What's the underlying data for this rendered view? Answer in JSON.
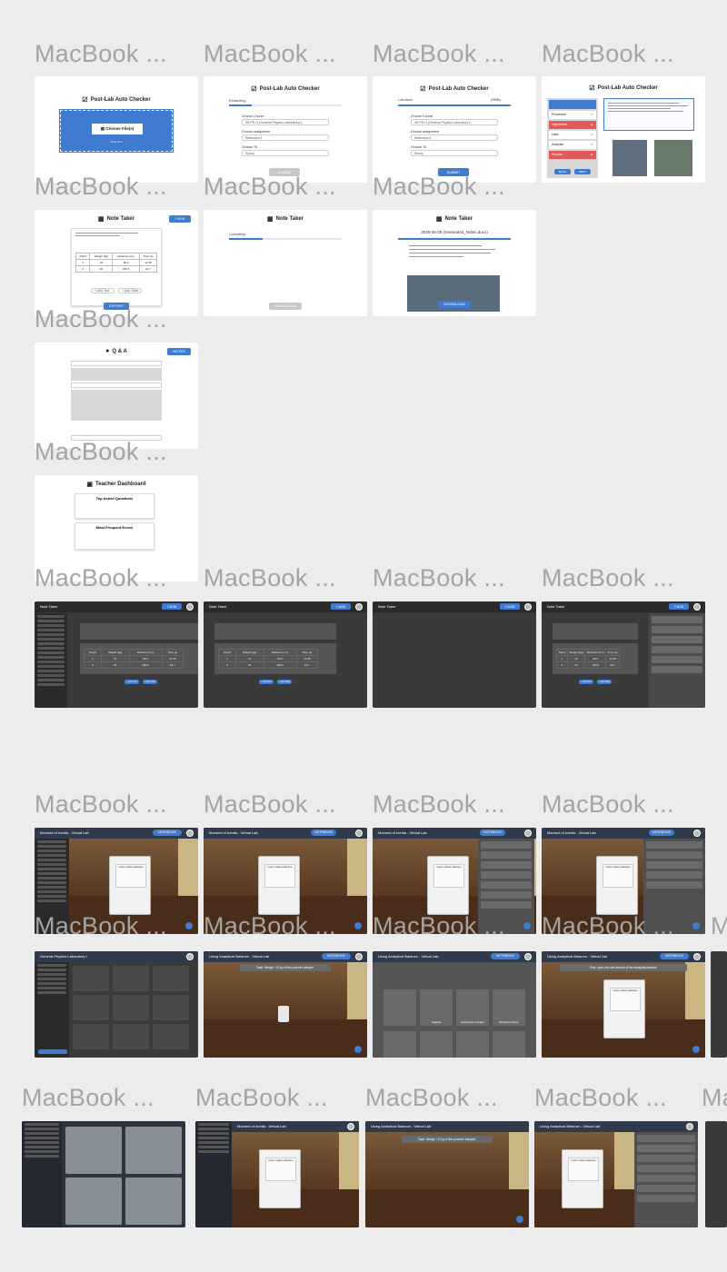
{
  "frame_label": "MacBook ...",
  "autochecker": {
    "title": "Post-Lab Auto Checker",
    "choose_files": "Choose File(s)",
    "drop_hint": "Drag files",
    "extracting": "Extracting...",
    "lab_docx": "Lab.docx",
    "size": "(5MB)",
    "choose_course": "Choose Course",
    "course_value": "4S-PH-H (General Physics Laboratory I)",
    "choose_assignment": "Choose assignment",
    "assignment_value": "Reflection 4",
    "choose_ta": "Choose TA",
    "ta_value": "Sunny",
    "submit": "SUBMIT",
    "steps": [
      "Procedure",
      "Hypothesis",
      "Data",
      "Analysis",
      "Results"
    ],
    "back": "BACK",
    "next": "NEXT"
  },
  "notetaker": {
    "title": "Note Taker",
    "ask": "? ASK",
    "compiling": "Compiling...",
    "download": "DOWNLOAD",
    "export": "EXPORT",
    "add_text": "+ Add Text",
    "add_table": "+ Add Table",
    "date_title": "2025-05-05 (Generated_Notes.docx)",
    "table_headers": [
      "Trial #",
      "Weight (kg)",
      "Distance (cm)",
      "Time (s)"
    ],
    "table_rows": [
      [
        "1",
        "10",
        "90.3",
        "12.35"
      ],
      [
        "2",
        "20",
        "180.5",
        "22.7"
      ]
    ]
  },
  "qa": {
    "title": "Q & A",
    "notes": "NOTES"
  },
  "teacher": {
    "title": "Teacher Dashboard",
    "top_questions": "Top Asked Questions",
    "frequent_errors": "Most Frequent Errors"
  },
  "virtual": {
    "moment_title": "Moment of Inertia - Virtual Lab",
    "balance_title": "Using Analytical Balance - Virtual Lab",
    "course_title": "General Physics Laboratory I",
    "notebook": "NOTEBOOK",
    "open_balance": "Open Glass balance",
    "task": "Task: Weigh ~0.2g of the powder sample.",
    "first_open": "First, open the side window of the analytical balance",
    "tools": [
      "Spatula",
      "Graduated Cylinder",
      "Weighing Paper"
    ]
  },
  "colors": {
    "accent": "#3e7bd1",
    "dark_bg": "#3a3a3a",
    "warn": "#e05a5a"
  }
}
